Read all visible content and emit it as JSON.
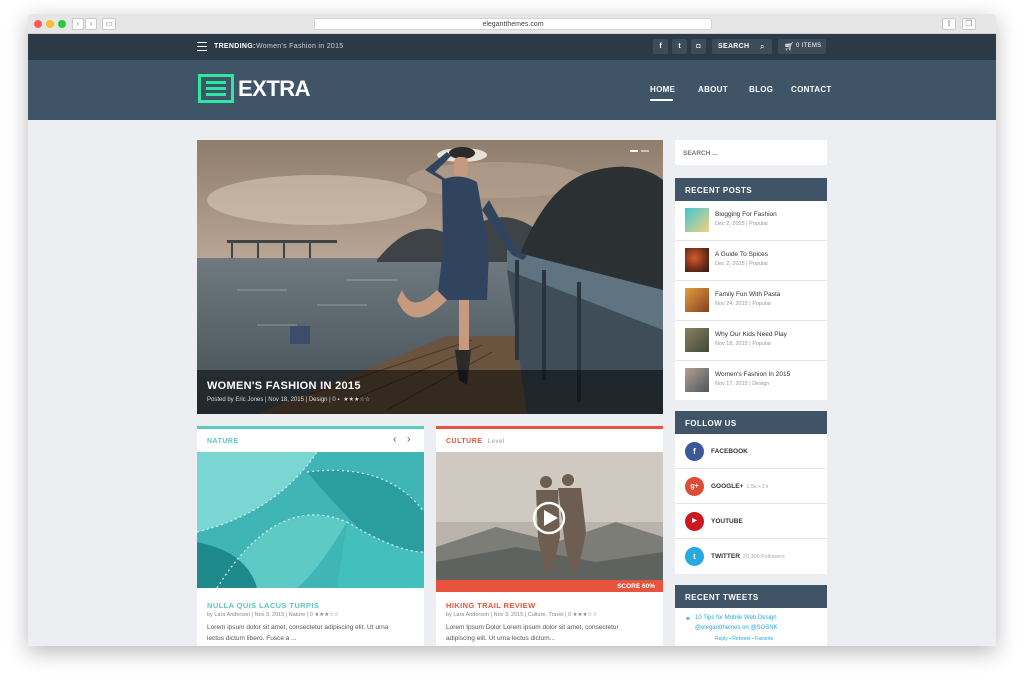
{
  "browser": {
    "url": "elegantthemes.com"
  },
  "topbar": {
    "trending_label": "TRENDING:",
    "trending_text": "Women's Fashion in 2015",
    "search_label": "SEARCH",
    "cart_label": "0 ITEMS",
    "social": [
      "f",
      "t",
      "ig"
    ]
  },
  "header": {
    "logo_text": "EXTRA",
    "nav": [
      "HOME",
      "ABOUT",
      "BLOG",
      "CONTACT"
    ]
  },
  "hero": {
    "title": "WOMEN'S FASHION IN 2015",
    "meta": "Posted by Eric Jones | Nov 18, 2015 | Design | 0",
    "rating": "★★★☆☆"
  },
  "nature": {
    "header": "NATURE",
    "title": "NULLA QUIS LACUS TURPIS",
    "meta": "by Lara Anderson | Nov 3, 2015 | Nature | 0",
    "rating": "★★★☆☆",
    "excerpt1": "Lorem ipsum dolor sit amet, consectetur adipiscing elit. Ut urna",
    "excerpt2": "lectus dictum libero. Fusce a ..."
  },
  "culture": {
    "header": "CULTURE",
    "sub": "Level",
    "score": "SCORE 60%",
    "title": "HIKING TRAIL REVIEW",
    "meta": "by Lara Anderson | Nov 3, 2015 | Culture, Travel | 0",
    "rating": "★★★☆☆",
    "excerpt1": "Lorem Ipsum Dolor Lorem ipsum dolor sit amet, consectetur",
    "excerpt2": "adipiscing elit. Ut urna lectus dictum..."
  },
  "sidebar": {
    "search_placeholder": "SEARCH ...",
    "recent_posts_title": "RECENT POSTS",
    "recent_posts": [
      {
        "title": "Blogging For Fashion",
        "meta": "Dec 2, 2015 | Popular"
      },
      {
        "title": "A Guide To Spices",
        "meta": "Dec 2, 2015 | Popular"
      },
      {
        "title": "Family Fun With Pasta",
        "meta": "Nov 24, 2015 | Popular"
      },
      {
        "title": "Why Our Kids Need Play",
        "meta": "Nov 18, 2015 | Popular"
      },
      {
        "title": "Women's Fashion In 2015",
        "meta": "Nov 17, 2015 | Design"
      }
    ],
    "follow_title": "FOLLOW US",
    "follow": [
      {
        "label": "FACEBOOK",
        "count": "",
        "color": "#3b5998",
        "glyph": "f"
      },
      {
        "label": "GOOGLE+",
        "count": "1.5k +1's",
        "color": "#dd4b39",
        "glyph": "g+"
      },
      {
        "label": "YOUTUBE",
        "count": "",
        "color": "#cc181e",
        "glyph": "▶"
      },
      {
        "label": "TWITTER",
        "count": "20,305 Followers",
        "color": "#29a9e1",
        "glyph": "t"
      }
    ],
    "tweets_title": "RECENT TWEETS",
    "tweet_text": "10 Tips for Mobile Web Design",
    "tweet_text2": "@elegantthemes on @SOSNK",
    "tweet_actions": "Reply • Retweet • Favorite"
  },
  "colors": {
    "brand_green": "#2ee8a0",
    "nature_accent": "#5bc8c2",
    "culture_accent": "#e8533d",
    "header_bg": "#3f5467",
    "topbar_bg": "#2c3a48"
  }
}
